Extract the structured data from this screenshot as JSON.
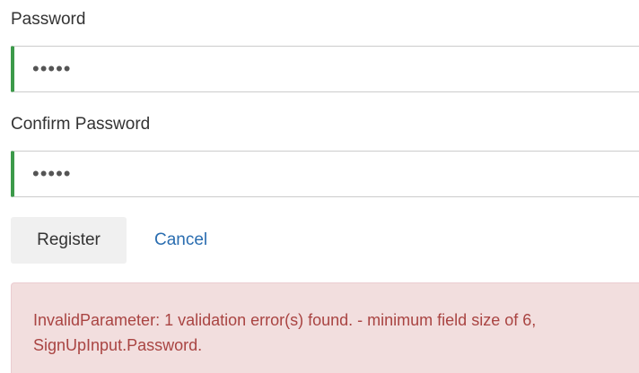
{
  "form": {
    "password": {
      "label": "Password",
      "value": "•••••"
    },
    "confirm_password": {
      "label": "Confirm Password",
      "value": "•••••"
    },
    "register_label": "Register",
    "cancel_label": "Cancel"
  },
  "alert": {
    "message": "InvalidParameter: 1 validation error(s) found. - minimum field size of 6, SignUpInput.Password."
  },
  "colors": {
    "valid_border": "#3c9a4a",
    "alert_background": "#f2dede",
    "alert_text": "#a94442",
    "link": "#2a6db0"
  }
}
